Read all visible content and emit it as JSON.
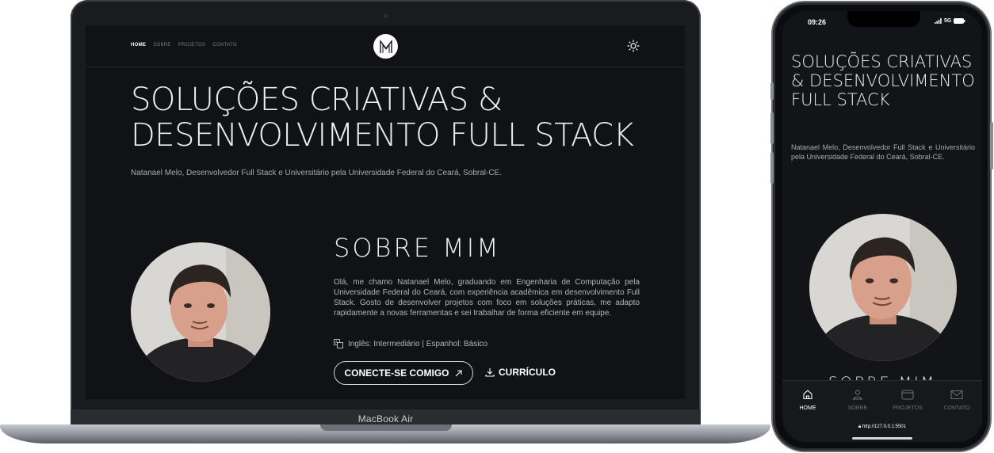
{
  "laptop": {
    "device_label": "MacBook Air",
    "nav": {
      "items": [
        "HOME",
        "SOBRE",
        "PROJETOS",
        "CONTATO"
      ],
      "active": "HOME"
    },
    "hero": {
      "title_line1": "SOLUÇÕES CRIATIVAS &",
      "title_line2": "DESENVOLVIMENTO FULL STACK",
      "subtitle": "Natanael Melo, Desenvolvedor Full Stack e Universitário pela Universidade Federal do Ceará, Sobral-CE."
    },
    "about": {
      "title": "SOBRE MIM",
      "text": "Olá, me chamo Natanael Melo, graduando em Engenharia de Computação pela Universidade Federal do Ceará, com experiência acadêmica em desenvolvimento Full Stack. Gosto de desenvolver projetos com foco em soluções práticas, me adapto rapidamente a novas ferramentas e sei trabalhar de forma eficiente em equipe.",
      "languages": "Inglês: Intermediário | Espanhol: Básico",
      "connect_label": "CONECTE-SE COMIGO",
      "cv_label": "CURRÍCULO"
    }
  },
  "phone": {
    "status": {
      "time": "09:26",
      "network": "5G"
    },
    "title": "SOLUÇÕES CRIATIVAS & DESENVOLVIMENTO FULL STACK",
    "subtitle": "Natanael Melo, Desenvolvedor Full Stack e Universitário pela Universidade Federal do Ceará, Sobral-CE.",
    "about_title": "SOBRE MIM",
    "tabs": [
      {
        "label": "HOME",
        "icon": "home-icon"
      },
      {
        "label": "SOBRE",
        "icon": "user-icon"
      },
      {
        "label": "PROJETOS",
        "icon": "folder-icon"
      },
      {
        "label": "CONTATO",
        "icon": "mail-icon"
      }
    ],
    "url": "http://127.0.0.1:5501"
  },
  "colors": {
    "background": "#111215",
    "text": "#eeeeef",
    "muted": "#a9aaaf",
    "accent": "#ffffff"
  }
}
